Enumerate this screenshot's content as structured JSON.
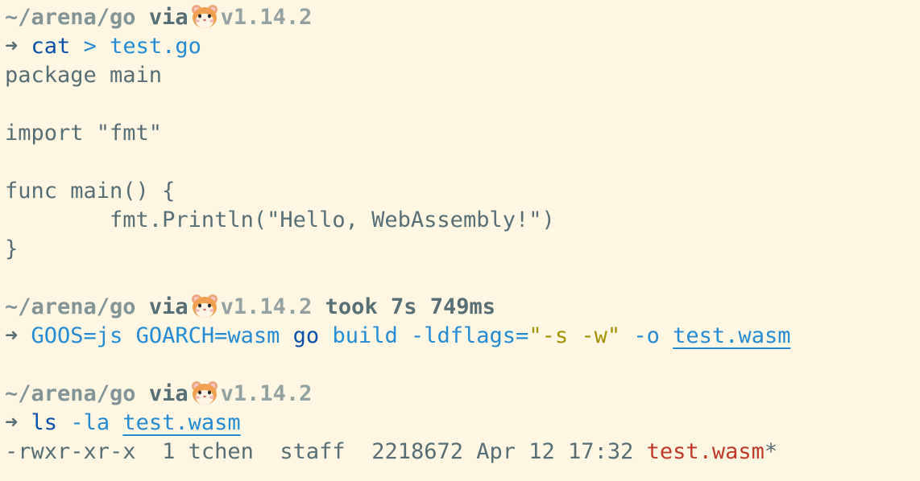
{
  "prompt": {
    "path": "~/arena/go",
    "via": "via",
    "version": "v1.14.2",
    "arrow": "➜",
    "took_label": "took",
    "took_value": "7s 749ms"
  },
  "commands": {
    "cat": {
      "program": "cat",
      "redirect": ">",
      "target": "test.go"
    },
    "build": {
      "env1": "GOOS=js",
      "env2": "GOARCH=wasm",
      "program": "go",
      "sub": "build",
      "flag": "-ldflags=",
      "flag_value": "\"-s -w\"",
      "out_flag": "-o",
      "target": "test.wasm"
    },
    "ls": {
      "program": "ls",
      "flag": "-la",
      "target": "test.wasm"
    }
  },
  "source_code": [
    "package main",
    "",
    "import \"fmt\"",
    "",
    "func main() {",
    "        fmt.Println(\"Hello, WebAssembly!\")",
    "}"
  ],
  "ls_output": {
    "perms": "-rwxr-xr-x",
    "links": "1",
    "owner": "tchen",
    "group": "staff",
    "size": "2218672",
    "date": "Apr 12 17:32",
    "name": "test.wasm",
    "suffix": "*"
  },
  "icons": {
    "go_env": "hamster-emoji-icon"
  }
}
